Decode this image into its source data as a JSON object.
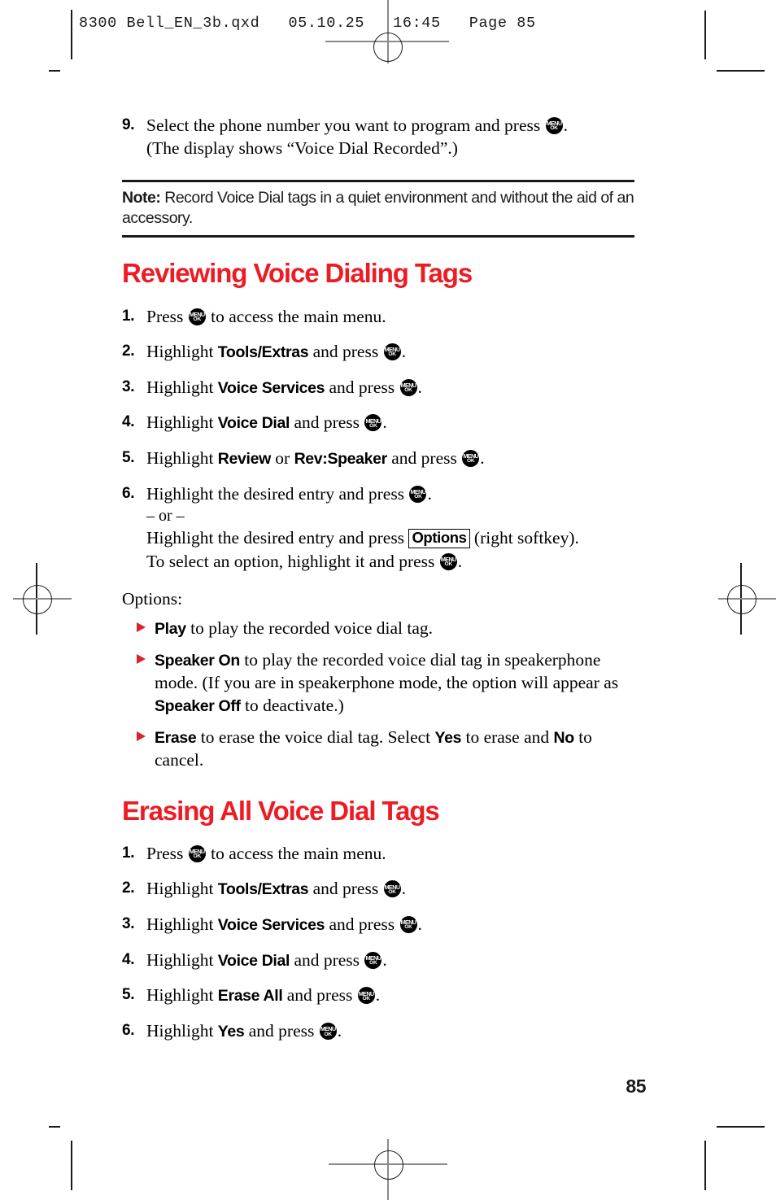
{
  "printer_slug": "8300 Bell_EN_3b.qxd   05.10.25   16:45   Page 85",
  "folio": "85",
  "colors": {
    "heading_red": "#ED1C24",
    "bullet_red": "#D8232A",
    "rule_black": "#1a1a1a"
  },
  "key_glyph": {
    "line1": "MENU",
    "line2": "OK"
  },
  "continued_step": {
    "num": "9.",
    "text_before_key": "Select the phone number you want to program and press ",
    "text_after_key": ".",
    "line2": "(The display shows “Voice Dial Recorded”.)"
  },
  "note": {
    "label": "Note:",
    "text": " Record Voice Dial tags in a quiet environment and without the aid of an accessory."
  },
  "section1": {
    "heading": "Reviewing Voice Dialing Tags",
    "steps": [
      {
        "num": "1.",
        "pre": "Press ",
        "post": " to access the main menu."
      },
      {
        "num": "2.",
        "pre": "Highlight ",
        "bold": "Tools/Extras",
        "mid": " and press ",
        "post": "."
      },
      {
        "num": "3.",
        "pre": "Highlight ",
        "bold": "Voice Services",
        "mid": " and press ",
        "post": "."
      },
      {
        "num": "4.",
        "pre": "Highlight ",
        "bold": "Voice Dial",
        "mid": " and press ",
        "post": "."
      },
      {
        "num": "5.",
        "pre": "Highlight ",
        "bold": "Review",
        "bold_sep": " or ",
        "bold2": "Rev:Speaker",
        "mid": " and press ",
        "post": "."
      }
    ],
    "step6": {
      "num": "6.",
      "line1_pre": "Highlight the desired entry and press ",
      "line1_post": ".",
      "or": "– or –",
      "line3_pre": "Highlight the desired entry and press ",
      "softkey": "Options",
      "line3_post": " (right softkey).",
      "line4_pre": "To select an option, highlight it and press ",
      "line4_post": "."
    },
    "options_label": "Options:",
    "options": [
      {
        "bold": "Play",
        "text": " to play the recorded voice dial tag."
      },
      {
        "bold": "Speaker On",
        "text": " to play the recorded voice dial tag in speakerphone mode. (If you are in speakerphone mode, the option will appear as ",
        "bold2": "Speaker Off",
        "text2": " to deactivate.)"
      },
      {
        "bold": "Erase",
        "text": " to erase the voice dial tag. Select ",
        "bold2": "Yes",
        "text2": " to erase and ",
        "bold3": "No",
        "text3": " to cancel."
      }
    ]
  },
  "section2": {
    "heading": "Erasing All Voice Dial Tags",
    "steps": [
      {
        "num": "1.",
        "pre": "Press ",
        "post": " to access the main menu."
      },
      {
        "num": "2.",
        "pre": "Highlight ",
        "bold": "Tools/Extras",
        "mid": " and press ",
        "post": "."
      },
      {
        "num": "3.",
        "pre": "Highlight ",
        "bold": "Voice Services",
        "mid": " and press ",
        "post": "."
      },
      {
        "num": "4.",
        "pre": "Highlight ",
        "bold": "Voice Dial",
        "mid": " and press ",
        "post": "."
      },
      {
        "num": "5.",
        "pre": "Highlight ",
        "bold": "Erase All",
        "mid": " and press ",
        "post": "."
      },
      {
        "num": "6.",
        "pre": "Highlight ",
        "bold": "Yes",
        "mid": " and press ",
        "post": "."
      }
    ]
  }
}
